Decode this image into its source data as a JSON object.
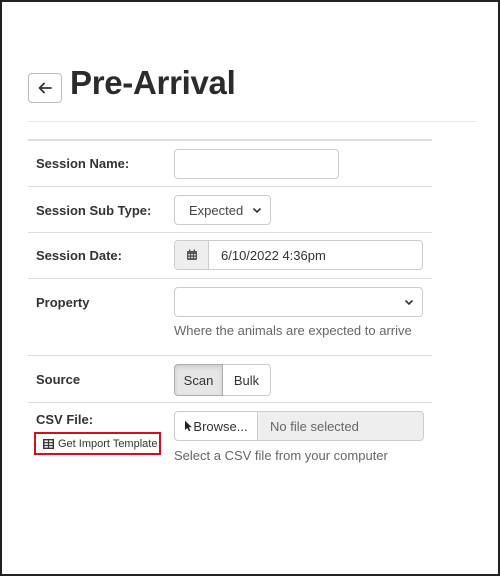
{
  "page": {
    "title": "Pre-Arrival"
  },
  "header": {
    "back_icon": "arrow-left-icon"
  },
  "form": {
    "session_name": {
      "label": "Session Name:",
      "value": ""
    },
    "session_sub_type": {
      "label": "Session Sub Type:",
      "value": "Expected"
    },
    "session_date": {
      "label": "Session Date:",
      "value": "6/10/2022 4:36pm",
      "icon": "calendar-icon"
    },
    "property": {
      "label": "Property",
      "value": "",
      "help": "Where the animals are expected to arrive"
    },
    "source": {
      "label": "Source",
      "options": [
        "Scan",
        "Bulk"
      ],
      "selected": "Scan"
    },
    "csv_file": {
      "label": "CSV File:",
      "browse_label": "Browse...",
      "file_placeholder": "No file selected",
      "help": "Select a CSV file from your computer",
      "template_link": "Get Import Template",
      "template_icon": "table-icon",
      "browse_icon": "cursor-pointer-icon"
    }
  },
  "colors": {
    "highlight": "#d0101e"
  }
}
